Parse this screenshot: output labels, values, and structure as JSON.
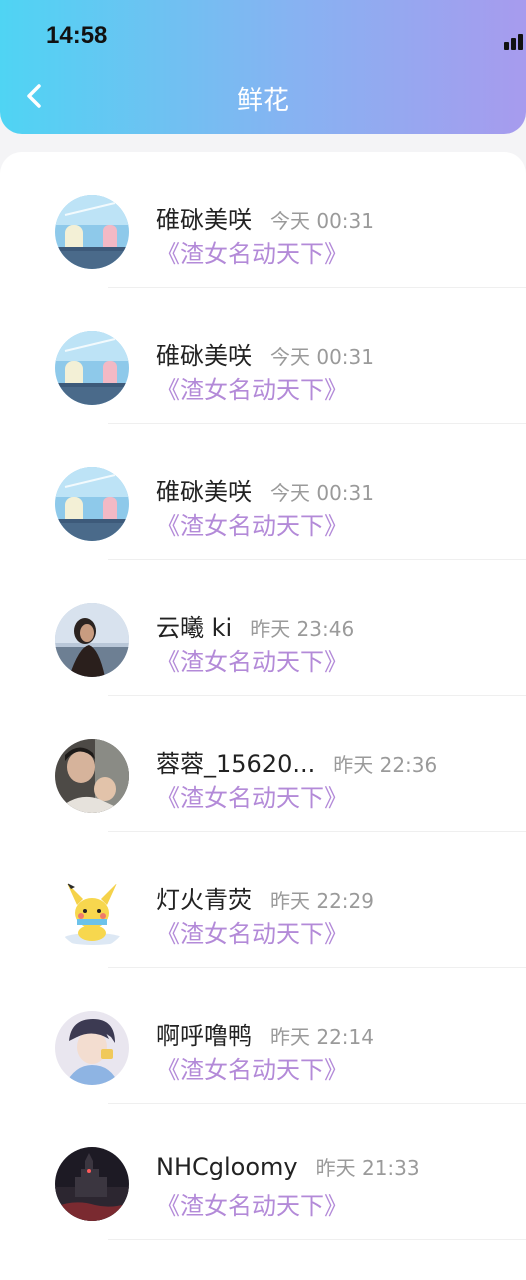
{
  "status_bar": {
    "time": "14:58"
  },
  "header": {
    "title": "鲜花"
  },
  "items": [
    {
      "name": "碓砯美咲",
      "time": "今天 00:31",
      "gift": "《渣女名动天下》",
      "avatar": "anime-sky-avatar"
    },
    {
      "name": "碓砯美咲",
      "time": "今天 00:31",
      "gift": "《渣女名动天下》",
      "avatar": "anime-sky-avatar"
    },
    {
      "name": "碓砯美咲",
      "time": "今天 00:31",
      "gift": "《渣女名动天下》",
      "avatar": "anime-sky-avatar"
    },
    {
      "name": "云曦 ki",
      "time": "昨天 23:46",
      "gift": "《渣女名动天下》",
      "avatar": "photo-woman-avatar"
    },
    {
      "name": "蓉蓉_15620...",
      "time": "昨天 22:36",
      "gift": "《渣女名动天下》",
      "avatar": "photo-family-avatar"
    },
    {
      "name": "灯火青荧",
      "time": "昨天 22:29",
      "gift": "《渣女名动天下》",
      "avatar": "pikachu-avatar"
    },
    {
      "name": "啊呼噜鸭",
      "time": "昨天 22:14",
      "gift": "《渣女名动天下》",
      "avatar": "anime-boy-avatar"
    },
    {
      "name": "NHCgloomy",
      "time": "昨天 21:33",
      "gift": "《渣女名动天下》",
      "avatar": "dark-castle-avatar"
    }
  ]
}
